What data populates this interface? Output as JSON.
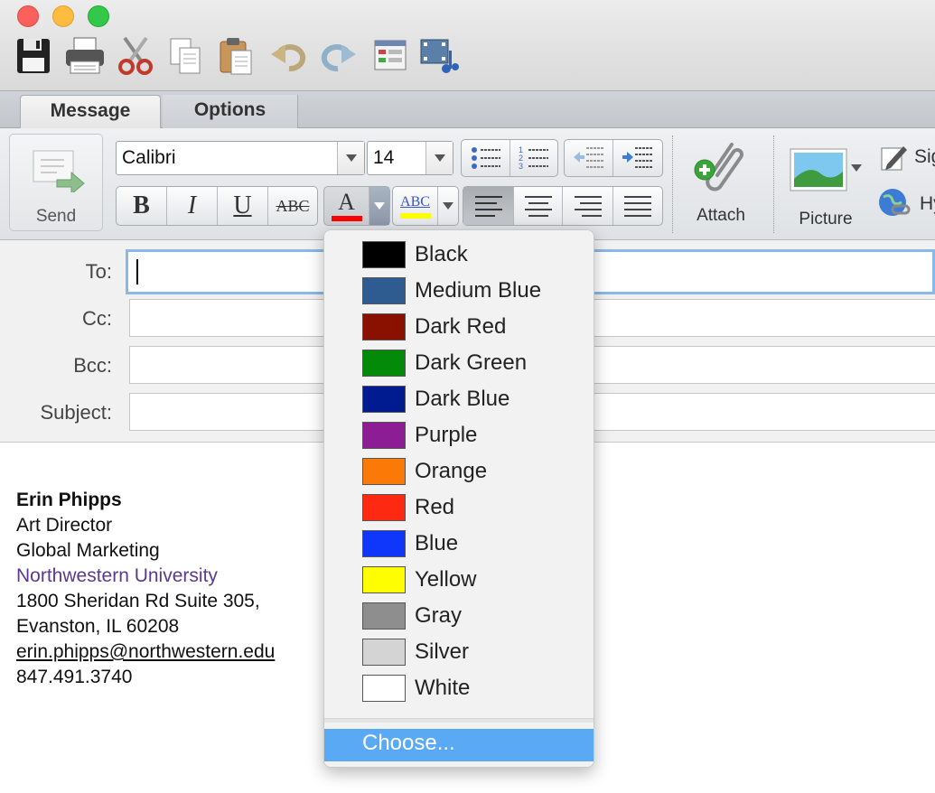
{
  "toolbar": {
    "icons": [
      "save-icon",
      "print-icon",
      "cut-icon",
      "copy-icon",
      "paste-icon",
      "undo-icon",
      "redo-icon",
      "toolbox-icon",
      "media-browser-icon"
    ]
  },
  "tabs": [
    {
      "label": "Message",
      "selected": true
    },
    {
      "label": "Options",
      "selected": false
    }
  ],
  "ribbon": {
    "send_label": "Send",
    "font_name": "Calibri",
    "font_size": "14",
    "bold_label": "B",
    "italic_label": "I",
    "underline_label": "U",
    "strikethrough_label": "ABC",
    "font_color_label": "A",
    "highlight_label": "ABC",
    "attach_label": "Attach",
    "picture_label": "Picture",
    "signature_label": "Sig",
    "hyperlink_label": "Hy",
    "font_color": "#ff0000",
    "highlight_color": "#ffff00"
  },
  "header": {
    "to_label": "To:",
    "cc_label": "Cc:",
    "bcc_label": "Bcc:",
    "subject_label": "Subject:",
    "to_value": "",
    "cc_value": "",
    "bcc_value": "",
    "subject_value": ""
  },
  "signature": {
    "name": "Erin Phipps",
    "title": "Art Director",
    "department": "Global Marketing",
    "organization": "Northwestern University",
    "address1": "1800 Sheridan Rd Suite 305,",
    "address2": "Evanston, IL 60208",
    "email": "erin.phipps@northwestern.edu",
    "phone": "847.491.3740",
    "organization_color": "#5b3a8e"
  },
  "color_menu": {
    "items": [
      {
        "label": "Black",
        "color": "#000000"
      },
      {
        "label": "Medium Blue",
        "color": "#2e5c91"
      },
      {
        "label": "Dark Red",
        "color": "#8a1000"
      },
      {
        "label": "Dark Green",
        "color": "#038a08"
      },
      {
        "label": "Dark Blue",
        "color": "#001b8f"
      },
      {
        "label": "Purple",
        "color": "#8c1d94"
      },
      {
        "label": "Orange",
        "color": "#fb7a07"
      },
      {
        "label": "Red",
        "color": "#fd2a11"
      },
      {
        "label": "Blue",
        "color": "#0f37fb"
      },
      {
        "label": "Yellow",
        "color": "#fefe00"
      },
      {
        "label": "Gray",
        "color": "#8e8e8e"
      },
      {
        "label": "Silver",
        "color": "#d4d4d4"
      },
      {
        "label": "White",
        "color": "#ffffff"
      }
    ],
    "choose_label": "Choose..."
  }
}
